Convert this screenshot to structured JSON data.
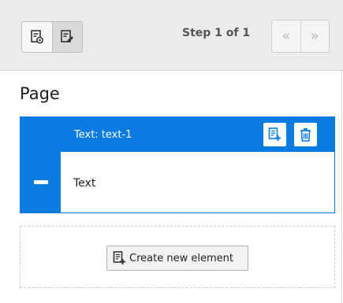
{
  "toolbar": {
    "view_buttons": [
      {
        "icon": "preview-icon",
        "active": false
      },
      {
        "icon": "edit-form-icon",
        "active": true
      }
    ],
    "step_label": "Step 1 of 1",
    "nav": {
      "prev_icon": "«",
      "next_icon": "»"
    }
  },
  "page": {
    "title": "Page",
    "element": {
      "header_title": "Text: text-1",
      "body_label": "Text",
      "header_buttons": [
        "add-element-icon",
        "trash-icon"
      ]
    },
    "create_button_label": "Create new element"
  },
  "colors": {
    "accent": "#0a7be0",
    "topbar": "#ebebeb"
  }
}
